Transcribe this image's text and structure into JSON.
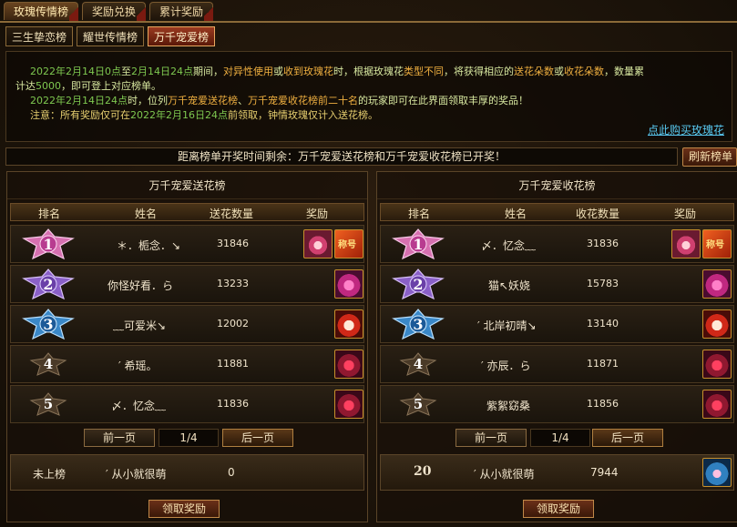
{
  "tabs_top": [
    "玫瑰传情榜",
    "奖励兑换",
    "累计奖励"
  ],
  "tabs_sub": [
    "三生挚恋榜",
    "耀世传情榜",
    "万千宠爱榜"
  ],
  "notice": {
    "l1a": "2022年2月14日0点",
    "l1b": "至",
    "l1c": "2月14日24点",
    "l1d": "期间，",
    "l1e": "对异性使用",
    "l1f": "或",
    "l1g": "收到玫瑰花",
    "l1h": "时，根据玫瑰花",
    "l1i": "类型不同",
    "l1j": "，将获得相应的",
    "l1k": "送花朵数",
    "l1l": "或",
    "l1m": "收花朵数",
    "l1n": "，数量累",
    "l2a": "计达",
    "l2b": "5000",
    "l2c": "，即可登上对应榜单。",
    "l3a": "2022年2月14日24点",
    "l3b": "时，位列",
    "l3c": "万千宠爱送花榜",
    "l3d": "、",
    "l3e": "万千宠爱收花榜",
    "l3f": "前二十名",
    "l3g": "的玩家即可在此界面领取丰厚的奖品！",
    "l4a": "注意：所有奖励仅可在",
    "l4b": "2022年2月16日24点",
    "l4c": "前领取，钟情玫瑰仅计入送花榜。",
    "buy_link": "点此购买玫瑰花"
  },
  "countdown": "距离榜单开奖时间剩余：万千宠爱送花榜和万千宠爱收花榜已开奖！",
  "refresh_label": "刷新榜单",
  "left": {
    "title": "万千宠爱送花榜",
    "headers": [
      "排名",
      "姓名",
      "送花数量",
      "奖励"
    ],
    "rows": [
      {
        "rank": "1",
        "name": "＊．栀念．↘",
        "count": "31846"
      },
      {
        "rank": "2",
        "name": "你怪好看．ら",
        "count": "13233"
      },
      {
        "rank": "3",
        "name": "﹏可爱米↘",
        "count": "12002"
      },
      {
        "rank": "4",
        "name": "′ 希瑶。",
        "count": "11881"
      },
      {
        "rank": "5",
        "name": "〆．忆念﹏",
        "count": "11836"
      }
    ],
    "prev": "前一页",
    "page": "1/4",
    "next": "后一页",
    "my_rank": "未上榜",
    "my_name": "′ 从小就很萌",
    "my_count": "0",
    "claim": "领取奖励"
  },
  "right": {
    "title": "万千宠爱收花榜",
    "headers": [
      "排名",
      "姓名",
      "收花数量",
      "奖励"
    ],
    "rows": [
      {
        "rank": "1",
        "name": "〆．忆念﹏",
        "count": "31836"
      },
      {
        "rank": "2",
        "name": "猫↖妖娆",
        "count": "15783"
      },
      {
        "rank": "3",
        "name": "′ 北岸初晴↘",
        "count": "13140"
      },
      {
        "rank": "4",
        "name": "′ 亦辰．ら",
        "count": "11871"
      },
      {
        "rank": "5",
        "name": "紫絮窈桑",
        "count": "11856"
      }
    ],
    "prev": "前一页",
    "page": "1/4",
    "next": "后一页",
    "my_rank": "20",
    "my_name": "′ 从小就很萌",
    "my_count": "7944",
    "claim": "领取奖励"
  }
}
